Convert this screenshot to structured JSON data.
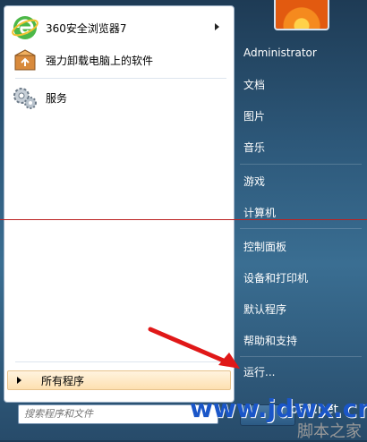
{
  "left_menu": {
    "items": [
      {
        "label": "360安全浏览器7"
      },
      {
        "label": "强力卸载电脑上的软件"
      },
      {
        "label": "服务"
      }
    ],
    "all_programs": "所有程序"
  },
  "search": {
    "placeholder": "搜索程序和文件"
  },
  "right_menu": {
    "items": [
      {
        "label": "Administrator"
      },
      {
        "label": "文档"
      },
      {
        "label": "图片"
      },
      {
        "label": "音乐"
      },
      {
        "label": "游戏"
      },
      {
        "label": "计算机"
      },
      {
        "label": "控制面板"
      },
      {
        "label": "设备和打印机"
      },
      {
        "label": "默认程序"
      },
      {
        "label": "帮助和支持"
      },
      {
        "label": "运行..."
      }
    ]
  },
  "watermark": {
    "site": "www.jdwx.cn",
    "site2": "jb51.net",
    "cn": "脚本之家"
  }
}
